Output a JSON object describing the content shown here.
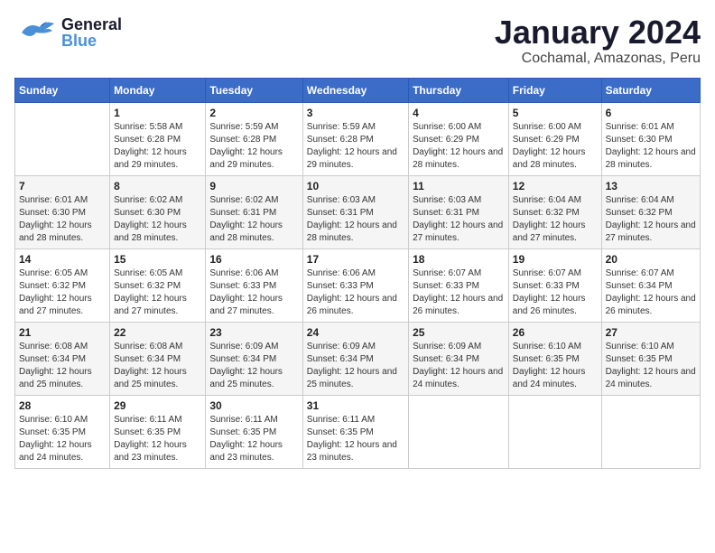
{
  "header": {
    "logo_general": "General",
    "logo_blue": "Blue",
    "title": "January 2024",
    "subtitle": "Cochamal, Amazonas, Peru"
  },
  "weekdays": [
    "Sunday",
    "Monday",
    "Tuesday",
    "Wednesday",
    "Thursday",
    "Friday",
    "Saturday"
  ],
  "weeks": [
    [
      {
        "num": "",
        "sunrise": "",
        "sunset": "",
        "daylight": ""
      },
      {
        "num": "1",
        "sunrise": "Sunrise: 5:58 AM",
        "sunset": "Sunset: 6:28 PM",
        "daylight": "Daylight: 12 hours and 29 minutes."
      },
      {
        "num": "2",
        "sunrise": "Sunrise: 5:59 AM",
        "sunset": "Sunset: 6:28 PM",
        "daylight": "Daylight: 12 hours and 29 minutes."
      },
      {
        "num": "3",
        "sunrise": "Sunrise: 5:59 AM",
        "sunset": "Sunset: 6:28 PM",
        "daylight": "Daylight: 12 hours and 29 minutes."
      },
      {
        "num": "4",
        "sunrise": "Sunrise: 6:00 AM",
        "sunset": "Sunset: 6:29 PM",
        "daylight": "Daylight: 12 hours and 28 minutes."
      },
      {
        "num": "5",
        "sunrise": "Sunrise: 6:00 AM",
        "sunset": "Sunset: 6:29 PM",
        "daylight": "Daylight: 12 hours and 28 minutes."
      },
      {
        "num": "6",
        "sunrise": "Sunrise: 6:01 AM",
        "sunset": "Sunset: 6:30 PM",
        "daylight": "Daylight: 12 hours and 28 minutes."
      }
    ],
    [
      {
        "num": "7",
        "sunrise": "Sunrise: 6:01 AM",
        "sunset": "Sunset: 6:30 PM",
        "daylight": "Daylight: 12 hours and 28 minutes."
      },
      {
        "num": "8",
        "sunrise": "Sunrise: 6:02 AM",
        "sunset": "Sunset: 6:30 PM",
        "daylight": "Daylight: 12 hours and 28 minutes."
      },
      {
        "num": "9",
        "sunrise": "Sunrise: 6:02 AM",
        "sunset": "Sunset: 6:31 PM",
        "daylight": "Daylight: 12 hours and 28 minutes."
      },
      {
        "num": "10",
        "sunrise": "Sunrise: 6:03 AM",
        "sunset": "Sunset: 6:31 PM",
        "daylight": "Daylight: 12 hours and 28 minutes."
      },
      {
        "num": "11",
        "sunrise": "Sunrise: 6:03 AM",
        "sunset": "Sunset: 6:31 PM",
        "daylight": "Daylight: 12 hours and 27 minutes."
      },
      {
        "num": "12",
        "sunrise": "Sunrise: 6:04 AM",
        "sunset": "Sunset: 6:32 PM",
        "daylight": "Daylight: 12 hours and 27 minutes."
      },
      {
        "num": "13",
        "sunrise": "Sunrise: 6:04 AM",
        "sunset": "Sunset: 6:32 PM",
        "daylight": "Daylight: 12 hours and 27 minutes."
      }
    ],
    [
      {
        "num": "14",
        "sunrise": "Sunrise: 6:05 AM",
        "sunset": "Sunset: 6:32 PM",
        "daylight": "Daylight: 12 hours and 27 minutes."
      },
      {
        "num": "15",
        "sunrise": "Sunrise: 6:05 AM",
        "sunset": "Sunset: 6:32 PM",
        "daylight": "Daylight: 12 hours and 27 minutes."
      },
      {
        "num": "16",
        "sunrise": "Sunrise: 6:06 AM",
        "sunset": "Sunset: 6:33 PM",
        "daylight": "Daylight: 12 hours and 27 minutes."
      },
      {
        "num": "17",
        "sunrise": "Sunrise: 6:06 AM",
        "sunset": "Sunset: 6:33 PM",
        "daylight": "Daylight: 12 hours and 26 minutes."
      },
      {
        "num": "18",
        "sunrise": "Sunrise: 6:07 AM",
        "sunset": "Sunset: 6:33 PM",
        "daylight": "Daylight: 12 hours and 26 minutes."
      },
      {
        "num": "19",
        "sunrise": "Sunrise: 6:07 AM",
        "sunset": "Sunset: 6:33 PM",
        "daylight": "Daylight: 12 hours and 26 minutes."
      },
      {
        "num": "20",
        "sunrise": "Sunrise: 6:07 AM",
        "sunset": "Sunset: 6:34 PM",
        "daylight": "Daylight: 12 hours and 26 minutes."
      }
    ],
    [
      {
        "num": "21",
        "sunrise": "Sunrise: 6:08 AM",
        "sunset": "Sunset: 6:34 PM",
        "daylight": "Daylight: 12 hours and 25 minutes."
      },
      {
        "num": "22",
        "sunrise": "Sunrise: 6:08 AM",
        "sunset": "Sunset: 6:34 PM",
        "daylight": "Daylight: 12 hours and 25 minutes."
      },
      {
        "num": "23",
        "sunrise": "Sunrise: 6:09 AM",
        "sunset": "Sunset: 6:34 PM",
        "daylight": "Daylight: 12 hours and 25 minutes."
      },
      {
        "num": "24",
        "sunrise": "Sunrise: 6:09 AM",
        "sunset": "Sunset: 6:34 PM",
        "daylight": "Daylight: 12 hours and 25 minutes."
      },
      {
        "num": "25",
        "sunrise": "Sunrise: 6:09 AM",
        "sunset": "Sunset: 6:34 PM",
        "daylight": "Daylight: 12 hours and 24 minutes."
      },
      {
        "num": "26",
        "sunrise": "Sunrise: 6:10 AM",
        "sunset": "Sunset: 6:35 PM",
        "daylight": "Daylight: 12 hours and 24 minutes."
      },
      {
        "num": "27",
        "sunrise": "Sunrise: 6:10 AM",
        "sunset": "Sunset: 6:35 PM",
        "daylight": "Daylight: 12 hours and 24 minutes."
      }
    ],
    [
      {
        "num": "28",
        "sunrise": "Sunrise: 6:10 AM",
        "sunset": "Sunset: 6:35 PM",
        "daylight": "Daylight: 12 hours and 24 minutes."
      },
      {
        "num": "29",
        "sunrise": "Sunrise: 6:11 AM",
        "sunset": "Sunset: 6:35 PM",
        "daylight": "Daylight: 12 hours and 23 minutes."
      },
      {
        "num": "30",
        "sunrise": "Sunrise: 6:11 AM",
        "sunset": "Sunset: 6:35 PM",
        "daylight": "Daylight: 12 hours and 23 minutes."
      },
      {
        "num": "31",
        "sunrise": "Sunrise: 6:11 AM",
        "sunset": "Sunset: 6:35 PM",
        "daylight": "Daylight: 12 hours and 23 minutes."
      },
      {
        "num": "",
        "sunrise": "",
        "sunset": "",
        "daylight": ""
      },
      {
        "num": "",
        "sunrise": "",
        "sunset": "",
        "daylight": ""
      },
      {
        "num": "",
        "sunrise": "",
        "sunset": "",
        "daylight": ""
      }
    ]
  ]
}
